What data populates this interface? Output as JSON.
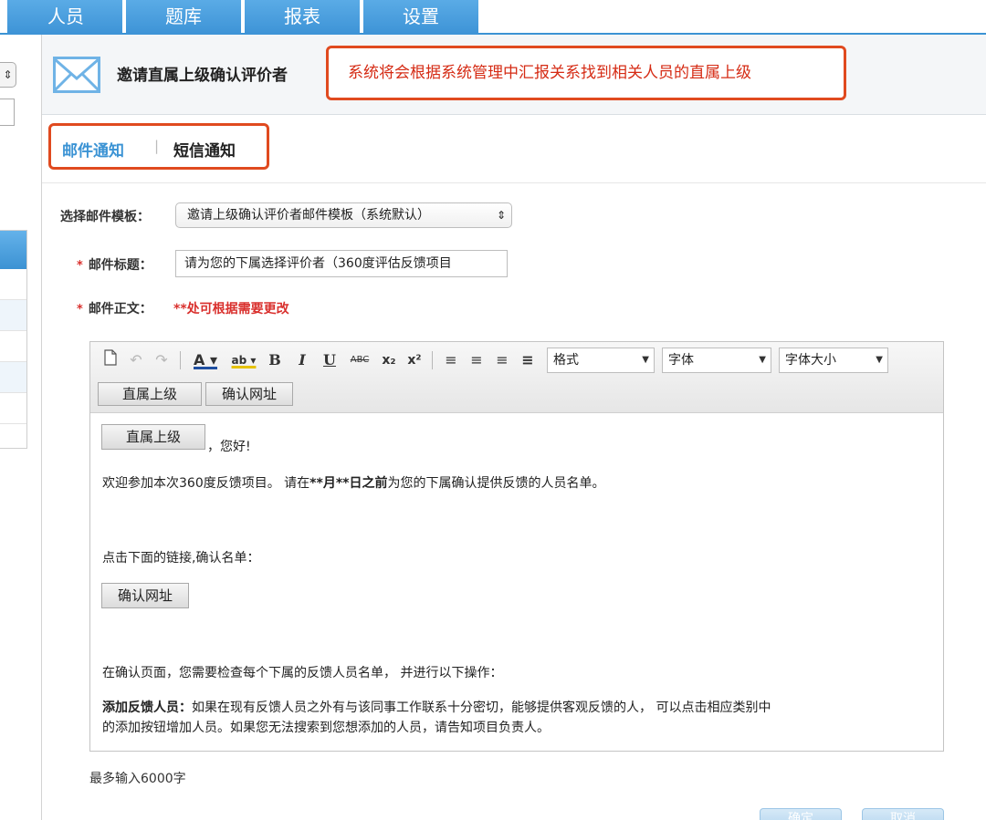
{
  "topnav": {
    "tabs": [
      {
        "label": "人员"
      },
      {
        "label": "题库"
      },
      {
        "label": "报表"
      },
      {
        "label": "设置"
      }
    ]
  },
  "sidebar": {
    "select_arrow": "⇕"
  },
  "dialog": {
    "title": "邀请直属上级确认评价者",
    "callout": "系统将会根据系统管理中汇报关系找到相关人员的直属上级"
  },
  "subtabs": {
    "mail": "邮件通知",
    "separator": "|",
    "sms": "短信通知"
  },
  "form": {
    "template_label": "选择邮件模板：",
    "template_value": "邀请上级确认评价者邮件模板（系统默认）",
    "subject_label": "邮件标题：",
    "subject_value": "请为您的下属选择评价者（360度评估反馈项目",
    "body_label": "邮件正文：",
    "body_note": "**处可根据需要更改",
    "required_mark": "*"
  },
  "toolbar": {
    "format_label": "格式",
    "font_label": "字体",
    "size_label": "字体大小",
    "insert_buttons": [
      "直属上级",
      "确认网址"
    ]
  },
  "editor_body": {
    "placeholder_superior": "直属上级",
    "greeting": "，您好!",
    "line1_a": "欢迎参加本次360度反馈项目。 请在",
    "line1_b": "**月**日之前",
    "line1_c": "为您的下属确认提供反馈的人员名单。",
    "line2": "点击下面的链接,确认名单：",
    "placeholder_url": "确认网址",
    "line3": "在确认页面，您需要检查每个下属的反馈人员名单， 并进行以下操作：",
    "line4_bold": "添加反馈人员：",
    "line4_rest": "如果在现有反馈人员之外有与该同事工作联系十分密切，能够提供客观反馈的人， 可以点击相应类别中",
    "line5": "的添加按钮增加人员。如果您无法搜索到您想添加的人员，请告知项目负责人。"
  },
  "footer": {
    "limit_note": "最多输入6000字",
    "confirm_label": "确定",
    "cancel_label": "取消"
  },
  "colors": {
    "accent": "#3b93d4",
    "highlight_border": "#e04a1f",
    "callout_text": "#d52b14",
    "required": "#d9302d"
  }
}
